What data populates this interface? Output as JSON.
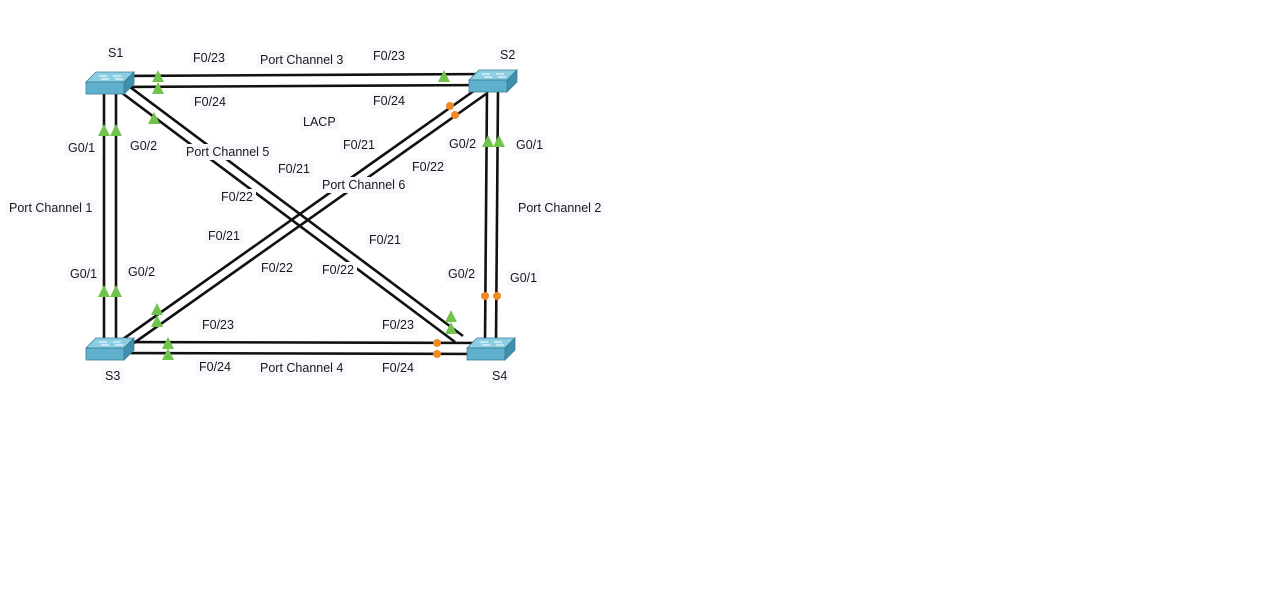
{
  "diagram": {
    "devices": [
      {
        "id": "S1",
        "label": "S1"
      },
      {
        "id": "S2",
        "label": "S2"
      },
      {
        "id": "S3",
        "label": "S3"
      },
      {
        "id": "S4",
        "label": "S4"
      }
    ],
    "protocol_label": "LACP",
    "links": [
      {
        "id": "pc3",
        "name": "Port Channel 3",
        "from": "S1",
        "to": "S2",
        "ports": [
          "F0/23",
          "F0/23",
          "F0/24",
          "F0/24"
        ]
      },
      {
        "id": "pc4",
        "name": "Port Channel 4",
        "from": "S3",
        "to": "S4",
        "ports": [
          "F0/23",
          "F0/23",
          "F0/24",
          "F0/24"
        ]
      },
      {
        "id": "pc1",
        "name": "Port Channel 1",
        "from": "S1",
        "to": "S3",
        "ports": [
          "G0/1",
          "G0/2",
          "G0/1",
          "G0/2"
        ]
      },
      {
        "id": "pc2",
        "name": "Port Channel 2",
        "from": "S2",
        "to": "S4",
        "ports": [
          "G0/2",
          "G0/1",
          "G0/2",
          "G0/1"
        ]
      },
      {
        "id": "pc5",
        "name": "Port Channel 5",
        "from": "S1",
        "to": "S4",
        "ports": [
          "F0/21",
          "F0/22",
          "F0/21",
          "F0/22"
        ]
      },
      {
        "id": "pc6",
        "name": "Port Channel 6",
        "from": "S2",
        "to": "S3",
        "ports": [
          "F0/21",
          "F0/22",
          "F0/21",
          "F0/22"
        ]
      }
    ],
    "status_colors": {
      "up": "#72c34c",
      "blocked": "#f08a24"
    },
    "device_color": "#5fb0cc"
  }
}
